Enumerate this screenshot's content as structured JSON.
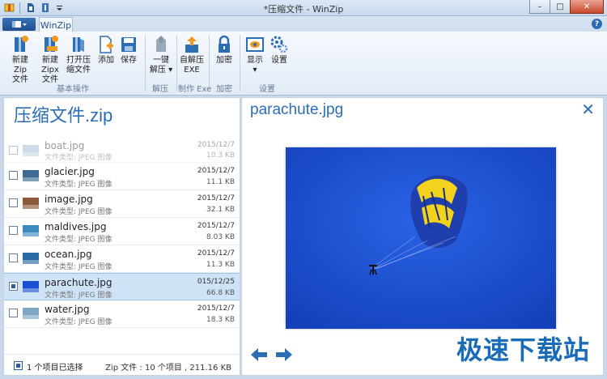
{
  "window": {
    "title": "*压缩文件 - WinZip",
    "controls": {
      "minimize": "–",
      "maximize": "□",
      "close": "✕"
    }
  },
  "ribbon": {
    "file_button_icon": "file-menu-icon",
    "active_tab": "WinZip",
    "help": "?",
    "buttons": [
      {
        "id": "new-zip",
        "label_line1": "新建Zip",
        "label_line2": "文件",
        "icon": "new-zip-icon"
      },
      {
        "id": "new-zipx",
        "label_line1": "新建Zipx",
        "label_line2": "文件",
        "icon": "new-zipx-icon"
      },
      {
        "id": "open-zip",
        "label_line1": "打开压",
        "label_line2": "缩文件",
        "icon": "open-zip-icon"
      },
      {
        "id": "add",
        "label_line1": "添加",
        "label_line2": "",
        "icon": "add-icon"
      },
      {
        "id": "save",
        "label_line1": "保存",
        "label_line2": "",
        "icon": "save-icon"
      },
      {
        "id": "unzip",
        "label_line1": "一键",
        "label_line2": "解压 ▾",
        "icon": "unzip-icon"
      },
      {
        "id": "self-extract",
        "label_line1": "自解压",
        "label_line2": "EXE",
        "icon": "self-extract-icon"
      },
      {
        "id": "encrypt",
        "label_line1": "加密",
        "label_line2": "",
        "icon": "lock-icon"
      },
      {
        "id": "view",
        "label_line1": "显示",
        "label_line2": "▾",
        "icon": "view-icon"
      },
      {
        "id": "settings",
        "label_line1": "设置",
        "label_line2": "",
        "icon": "gear-icon"
      }
    ],
    "groups": [
      "基本操作",
      "解压",
      "制作 Exe",
      "加密",
      "设置"
    ]
  },
  "zip": {
    "title": "压缩文件.zip",
    "files": [
      {
        "name": "boat.jpg",
        "type": "文件类型: JPEG 图像",
        "date": "2015/12/7",
        "size": "10.3 KB",
        "faded": true,
        "selected": false,
        "thumb_color": "#8fb1cf"
      },
      {
        "name": "glacier.jpg",
        "type": "文件类型: JPEG 图像",
        "date": "2015/12/7",
        "size": "11.1 KB",
        "faded": false,
        "selected": false,
        "thumb_color": "#3f6c95"
      },
      {
        "name": "image.jpg",
        "type": "文件类型: JPEG 图像",
        "date": "2015/12/7",
        "size": "32.1 KB",
        "faded": false,
        "selected": false,
        "thumb_color": "#8a5a3a"
      },
      {
        "name": "maldives.jpg",
        "type": "文件类型: JPEG 图像",
        "date": "2015/12/7",
        "size": "8.03 KB",
        "faded": false,
        "selected": false,
        "thumb_color": "#3d8ac0"
      },
      {
        "name": "ocean.jpg",
        "type": "文件类型: JPEG 图像",
        "date": "2015/12/7",
        "size": "11.3 KB",
        "faded": false,
        "selected": false,
        "thumb_color": "#2a6aa6"
      },
      {
        "name": "parachute.jpg",
        "type": "文件类型: JPEG 图像",
        "date": "015/12/25",
        "size": "66.8 KB",
        "faded": false,
        "selected": true,
        "thumb_color": "#1b4fd1"
      },
      {
        "name": "water.jpg",
        "type": "文件类型: JPEG 图像",
        "date": "2015/12/7",
        "size": "18.3 KB",
        "faded": false,
        "selected": false,
        "thumb_color": "#7fa6c5"
      }
    ],
    "status_selected": "1 个项目已选择",
    "status_info": "Zip 文件 : 10 个项目 , 211.16 KB"
  },
  "preview": {
    "title": "parachute.jpg",
    "close_icon": "close-icon",
    "prev_icon": "arrow-left-icon",
    "next_icon": "arrow-right-icon"
  },
  "watermark": "极速下载站",
  "colors": {
    "accent": "#2c6db3",
    "sky": "#1b4fd1",
    "selection": "#cfe3f7"
  }
}
